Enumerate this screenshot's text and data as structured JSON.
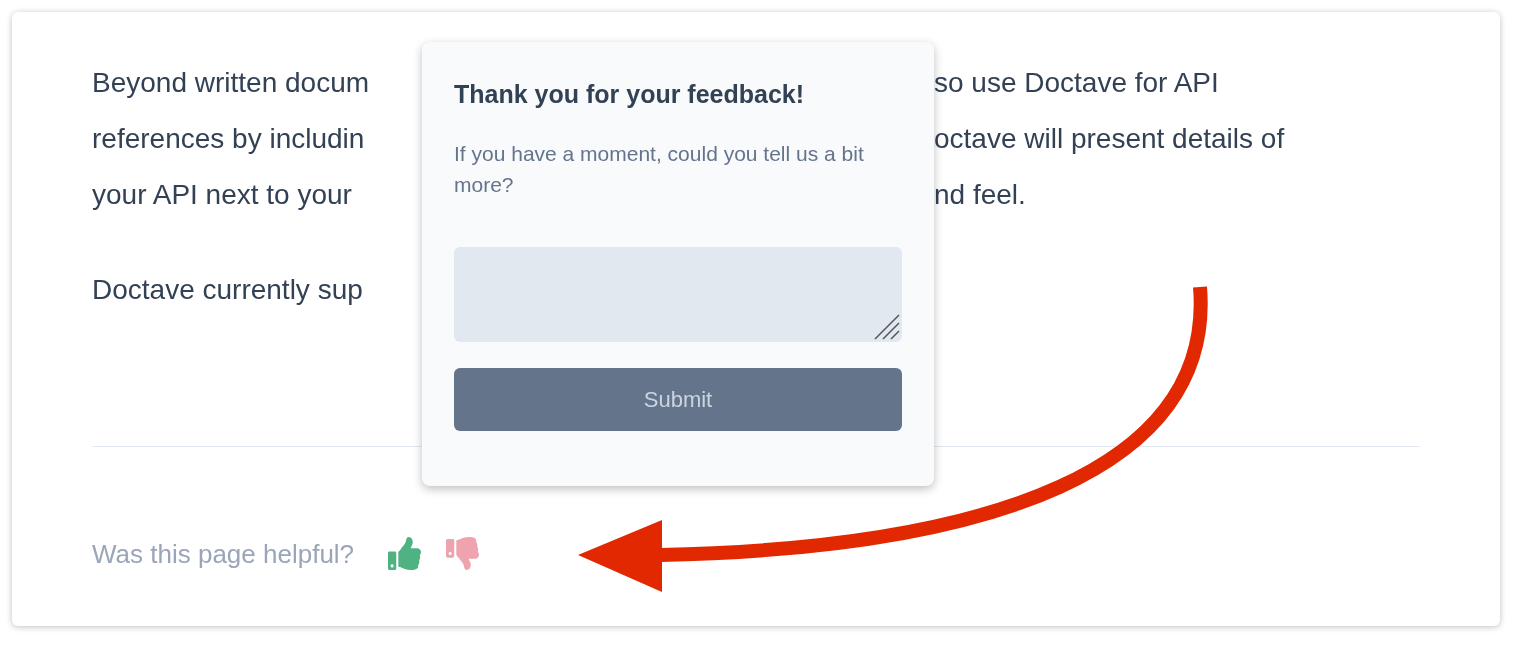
{
  "paragraphs": [
    {
      "lines": [
        {
          "left": "Beyond written docum",
          "right": "so use Doctave for API"
        },
        {
          "left": "references by includin",
          "right": "octave will present details of"
        },
        {
          "left": "your API next to your",
          "right": "nd feel."
        }
      ]
    },
    {
      "lines": [
        {
          "left": "Doctave currently sup"
        }
      ]
    }
  ],
  "feedback": {
    "question": "Was this page helpful?"
  },
  "popover": {
    "title": "Thank you for your feedback!",
    "message": "If you have a moment, could you tell us a bit more?",
    "submit": "Submit"
  }
}
